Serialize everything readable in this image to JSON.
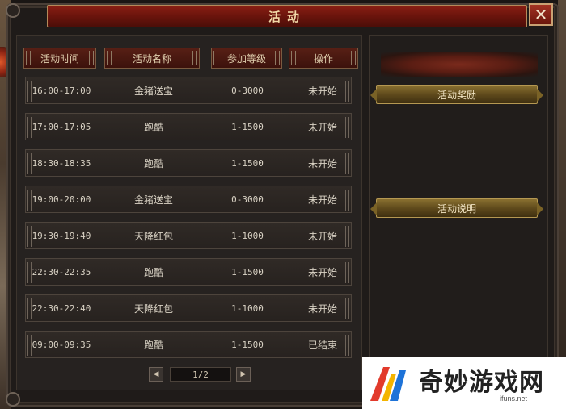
{
  "window": {
    "title": "活动"
  },
  "table": {
    "headers": [
      "活动时间",
      "活动名称",
      "参加等级",
      "操作"
    ],
    "rows": [
      {
        "time": "16:00-17:00",
        "name": "金猪送宝",
        "level": "0-3000",
        "status": "未开始"
      },
      {
        "time": "17:00-17:05",
        "name": "跑酷",
        "level": "1-1500",
        "status": "未开始"
      },
      {
        "time": "18:30-18:35",
        "name": "跑酷",
        "level": "1-1500",
        "status": "未开始"
      },
      {
        "time": "19:00-20:00",
        "name": "金猪送宝",
        "level": "0-3000",
        "status": "未开始"
      },
      {
        "time": "19:30-19:40",
        "name": "天降红包",
        "level": "1-1000",
        "status": "未开始"
      },
      {
        "time": "22:30-22:35",
        "name": "跑酷",
        "level": "1-1500",
        "status": "未开始"
      },
      {
        "time": "22:30-22:40",
        "name": "天降红包",
        "level": "1-1000",
        "status": "未开始"
      },
      {
        "time": "09:00-09:35",
        "name": "跑酷",
        "level": "1-1500",
        "status": "已结束"
      }
    ]
  },
  "pager": {
    "text": "1/2",
    "prev_icon": "triangle-left-icon",
    "next_icon": "triangle-right-icon"
  },
  "side": {
    "reward_label": "活动奖励",
    "desc_label": "活动说明"
  },
  "watermark": {
    "brand": "奇妙游戏网",
    "url": "ifuns.net"
  },
  "colors": {
    "title_bar": "#6a140c",
    "accent_gold": "#b59852",
    "row_bg": "#2b2623"
  }
}
